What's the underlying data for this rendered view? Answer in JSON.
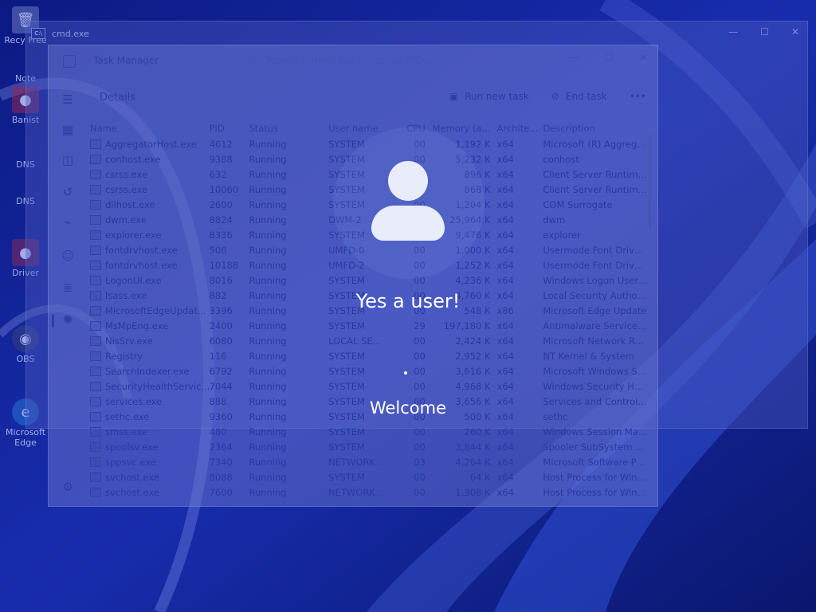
{
  "desktop": {
    "icons": [
      {
        "label": "Recy Free",
        "icon": "recycle-bin-icon"
      },
      {
        "label": "Note",
        "icon": "notepad-icon"
      },
      {
        "label": "Banist",
        "icon": "app-icon"
      },
      {
        "label": "DNS",
        "icon": "dns-icon"
      },
      {
        "label": "DNS",
        "icon": "dns-icon"
      },
      {
        "label": "Driver",
        "icon": "driver-icon"
      },
      {
        "label": "OBS",
        "icon": "obs-icon"
      },
      {
        "label": "Microsoft Edge",
        "icon": "edge-icon"
      }
    ]
  },
  "console": {
    "title": "cmd.exe"
  },
  "task_manager": {
    "title": "Task Manager",
    "search_placeholder": "Type a name, publisher, or PID...",
    "section_title": "Details",
    "run_new_task": "Run new task",
    "end_task": "End task",
    "more": "•••",
    "columns": [
      "Name",
      "PID",
      "Status",
      "User name",
      "CPU",
      "Memory (a...",
      "Archite...",
      "Description"
    ],
    "rows": [
      {
        "name": "AggregatorHost.exe",
        "pid": "4612",
        "status": "Running",
        "user": "SYSTEM",
        "cpu": "00",
        "mem": "1,192 K",
        "arch": "x64",
        "desc": "Microsoft (R) Aggrega..."
      },
      {
        "name": "conhost.exe",
        "pid": "9388",
        "status": "Running",
        "user": "SYSTEM",
        "cpu": "00",
        "mem": "5,232 K",
        "arch": "x64",
        "desc": "conhost"
      },
      {
        "name": "csrss.exe",
        "pid": "632",
        "status": "Running",
        "user": "SYSTEM",
        "cpu": "00",
        "mem": "896 K",
        "arch": "x64",
        "desc": "Client Server Runtime ..."
      },
      {
        "name": "csrss.exe",
        "pid": "10060",
        "status": "Running",
        "user": "SYSTEM",
        "cpu": "00",
        "mem": "868 K",
        "arch": "x64",
        "desc": "Client Server Runtime ..."
      },
      {
        "name": "dllhost.exe",
        "pid": "2600",
        "status": "Running",
        "user": "SYSTEM",
        "cpu": "00",
        "mem": "1,204 K",
        "arch": "x64",
        "desc": "COM Surrogate"
      },
      {
        "name": "dwm.exe",
        "pid": "8824",
        "status": "Running",
        "user": "DWM-2",
        "cpu": "00",
        "mem": "25,964 K",
        "arch": "x64",
        "desc": "dwm"
      },
      {
        "name": "explorer.exe",
        "pid": "8336",
        "status": "Running",
        "user": "SYSTEM",
        "cpu": "00",
        "mem": "9,476 K",
        "arch": "x64",
        "desc": "explorer"
      },
      {
        "name": "fontdrvhost.exe",
        "pid": "508",
        "status": "Running",
        "user": "UMFD-0",
        "cpu": "00",
        "mem": "1,000 K",
        "arch": "x64",
        "desc": "Usermode Font Driver ..."
      },
      {
        "name": "fontdrvhost.exe",
        "pid": "10188",
        "status": "Running",
        "user": "UMFD-2",
        "cpu": "00",
        "mem": "1,252 K",
        "arch": "x64",
        "desc": "Usermode Font Driver ..."
      },
      {
        "name": "LogonUI.exe",
        "pid": "8016",
        "status": "Running",
        "user": "SYSTEM",
        "cpu": "00",
        "mem": "4,236 K",
        "arch": "x64",
        "desc": "Windows Logon User I..."
      },
      {
        "name": "lsass.exe",
        "pid": "882",
        "status": "Running",
        "user": "SYSTEM",
        "cpu": "00",
        "mem": "4,760 K",
        "arch": "x64",
        "desc": "Local Security Authori..."
      },
      {
        "name": "MicrosoftEdgeUpdat...",
        "pid": "3396",
        "status": "Running",
        "user": "SYSTEM",
        "cpu": "00",
        "mem": "548 K",
        "arch": "x86",
        "desc": "Microsoft Edge Update"
      },
      {
        "name": "MsMpEng.exe",
        "pid": "2400",
        "status": "Running",
        "user": "SYSTEM",
        "cpu": "29",
        "mem": "197,180 K",
        "arch": "x64",
        "desc": "Antimalware Service E..."
      },
      {
        "name": "NisSrv.exe",
        "pid": "6080",
        "status": "Running",
        "user": "LOCAL SE...",
        "cpu": "00",
        "mem": "2,424 K",
        "arch": "x64",
        "desc": "Microsoft Network Re..."
      },
      {
        "name": "Registry",
        "pid": "116",
        "status": "Running",
        "user": "SYSTEM",
        "cpu": "00",
        "mem": "2,952 K",
        "arch": "x64",
        "desc": "NT Kernel & System"
      },
      {
        "name": "SearchIndexer.exe",
        "pid": "6792",
        "status": "Running",
        "user": "SYSTEM",
        "cpu": "00",
        "mem": "3,616 K",
        "arch": "x64",
        "desc": "Microsoft Windows Se..."
      },
      {
        "name": "SecurityHealthServic...",
        "pid": "7044",
        "status": "Running",
        "user": "SYSTEM",
        "cpu": "00",
        "mem": "4,968 K",
        "arch": "x64",
        "desc": "Windows Security Hea..."
      },
      {
        "name": "services.exe",
        "pid": "888",
        "status": "Running",
        "user": "SYSTEM",
        "cpu": "00",
        "mem": "3,656 K",
        "arch": "x64",
        "desc": "Services and Controlle..."
      },
      {
        "name": "sethc.exe",
        "pid": "9360",
        "status": "Running",
        "user": "SYSTEM",
        "cpu": "00",
        "mem": "500 K",
        "arch": "x64",
        "desc": "sethc"
      },
      {
        "name": "smss.exe",
        "pid": "480",
        "status": "Running",
        "user": "SYSTEM",
        "cpu": "00",
        "mem": "260 K",
        "arch": "x64",
        "desc": "Windows Session Man..."
      },
      {
        "name": "spoolsv.exe",
        "pid": "2364",
        "status": "Running",
        "user": "SYSTEM",
        "cpu": "00",
        "mem": "3,844 K",
        "arch": "x64",
        "desc": "Spooler SubSystem App"
      },
      {
        "name": "sppsvc.exe",
        "pid": "7340",
        "status": "Running",
        "user": "NETWORK...",
        "cpu": "03",
        "mem": "4,264 K",
        "arch": "x64",
        "desc": "Microsoft Software Pr..."
      },
      {
        "name": "svchost.exe",
        "pid": "8088",
        "status": "Running",
        "user": "SYSTEM",
        "cpu": "00",
        "mem": "64 K",
        "arch": "x64",
        "desc": "Host Process for Wind..."
      },
      {
        "name": "svchost.exe",
        "pid": "7600",
        "status": "Running",
        "user": "NETWORK...",
        "cpu": "00",
        "mem": "1,308 K",
        "arch": "x64",
        "desc": "Host Process for Wind..."
      }
    ]
  },
  "lock": {
    "username": "Yes a user!",
    "status": "Welcome"
  },
  "colors": {
    "overlay_text": "#ffffff",
    "avatar": "#e9ecfb",
    "wallpaper_base": "#0b1a7a"
  }
}
